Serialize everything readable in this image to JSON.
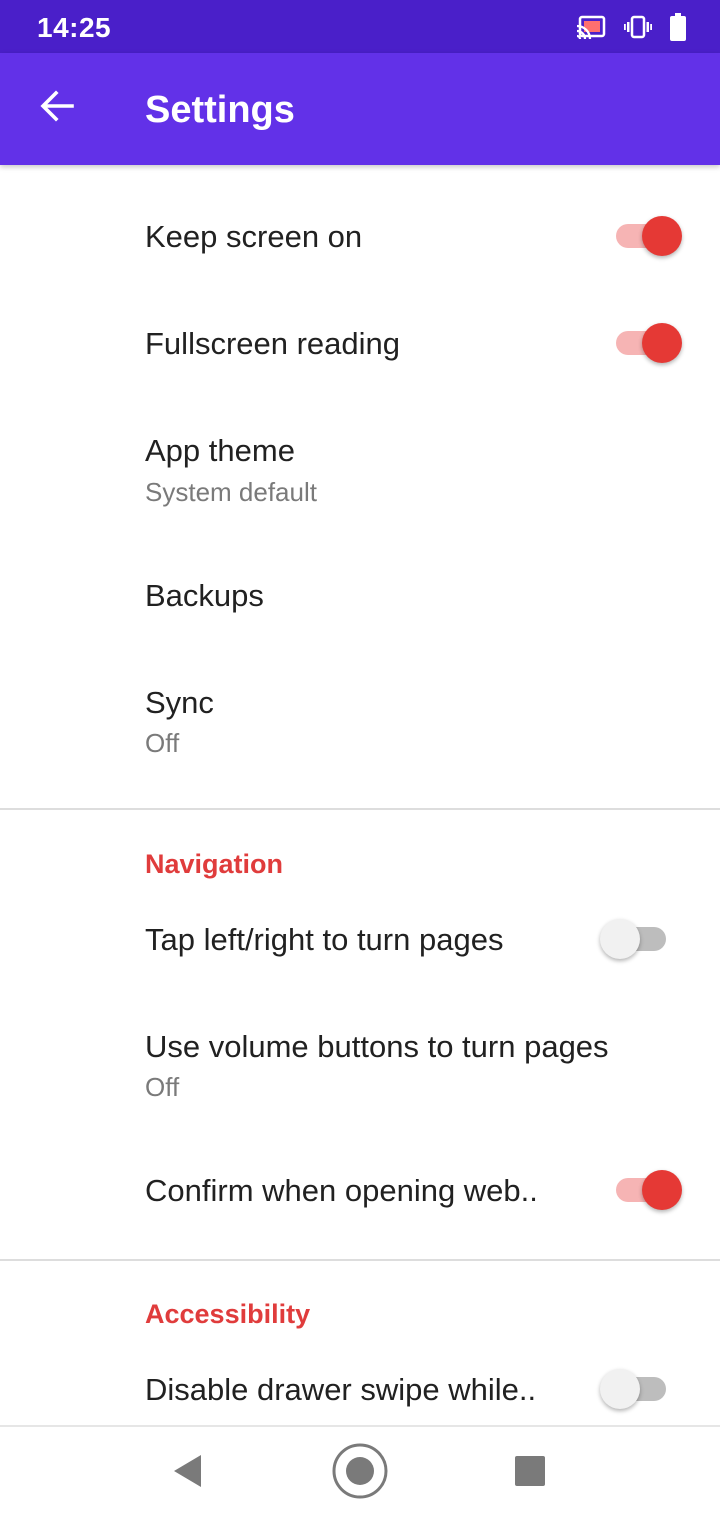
{
  "status_bar": {
    "time": "14:25",
    "icons": [
      "cast-icon",
      "vibrate-icon",
      "battery-icon"
    ]
  },
  "app_bar": {
    "title": "Settings",
    "back_icon": "arrow-left-icon"
  },
  "colors": {
    "status_bar": "#4a1fc9",
    "app_bar": "#6231e8",
    "accent": "#e53935",
    "section_header": "#e03c3c"
  },
  "settings": {
    "keep_screen_on": {
      "title": "Keep screen on",
      "enabled": true
    },
    "fullscreen_reading": {
      "title": "Fullscreen reading",
      "enabled": true
    },
    "app_theme": {
      "title": "App theme",
      "summary": "System default"
    },
    "backups": {
      "title": "Backups"
    },
    "sync": {
      "title": "Sync",
      "summary": "Off"
    }
  },
  "navigation": {
    "header": "Navigation",
    "tap_to_turn": {
      "title": "Tap left/right to turn pages",
      "enabled": false
    },
    "volume_buttons": {
      "title": "Use volume buttons to turn pages",
      "summary": "Off"
    },
    "confirm_web": {
      "title": "Confirm when opening web..",
      "enabled": true
    }
  },
  "accessibility": {
    "header": "Accessibility",
    "disable_drawer_swipe": {
      "title": "Disable drawer swipe while..",
      "enabled": false
    }
  },
  "nav_bar": {
    "icons": [
      "back-triangle-icon",
      "home-circle-icon",
      "recents-square-icon"
    ]
  }
}
